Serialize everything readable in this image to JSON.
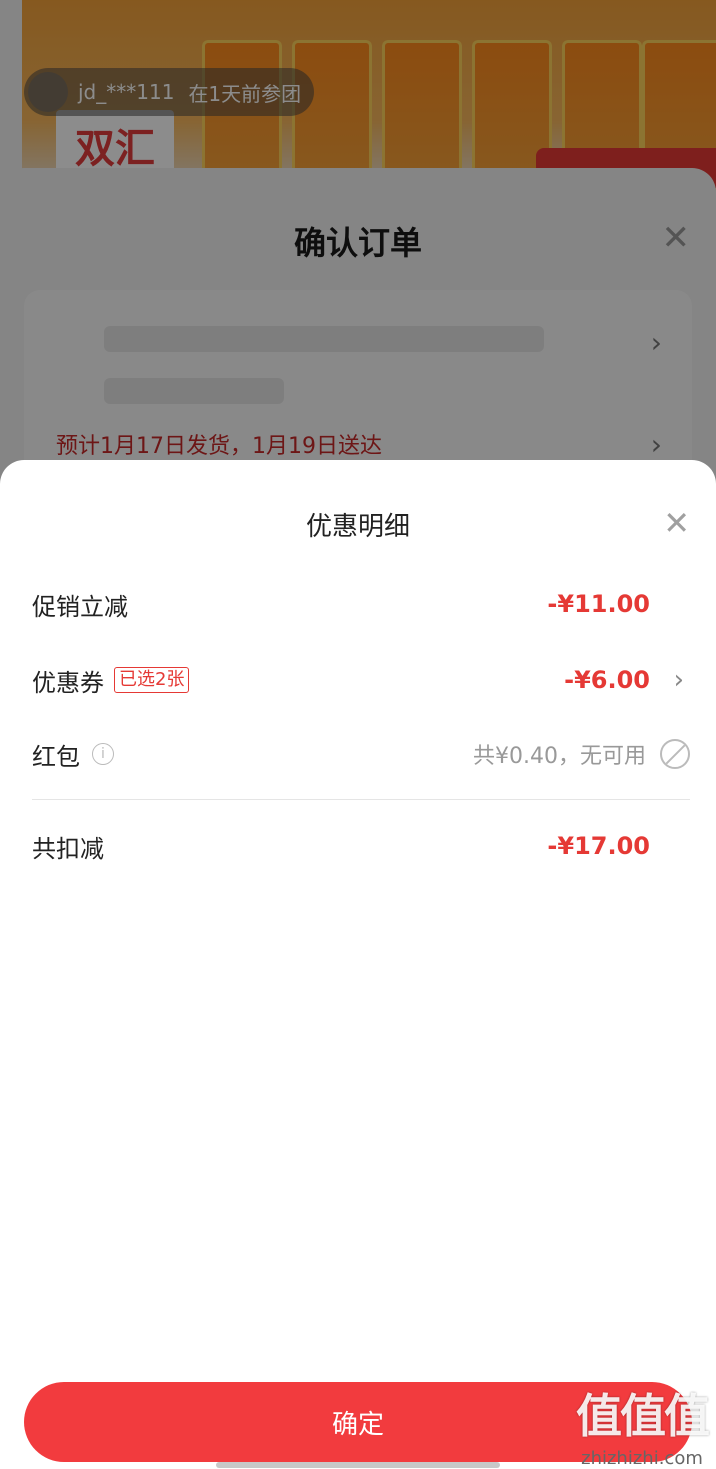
{
  "background": {
    "group_user": "jd_***111",
    "group_time": "在1天前参团",
    "brand_logo": "双汇",
    "order_sheet": {
      "title": "确认订单",
      "close_icon": "close-icon",
      "delivery_text": "预计1月17日发货，1月19日送达"
    }
  },
  "discount_panel": {
    "title": "优惠明细",
    "close_icon": "close-icon",
    "rows": [
      {
        "label": "促销立减",
        "amount": "-¥11.00"
      },
      {
        "label": "优惠券",
        "badge": "已选2张",
        "amount": "-¥6.00"
      },
      {
        "label": "红包",
        "info_icon": "info-icon",
        "amount_text": "共¥0.40，无可用",
        "status_icon": "unavailable-icon"
      },
      {
        "label": "共扣减",
        "amount": "-¥17.00"
      }
    ],
    "confirm_label": "确定"
  },
  "watermark": {
    "logo": "值值值",
    "url": "zhizhizhi.com"
  },
  "colors": {
    "accent_red": "#f23b3e",
    "amount_red": "#e53935",
    "overlay": "rgba(0,0,0,0.45)"
  }
}
